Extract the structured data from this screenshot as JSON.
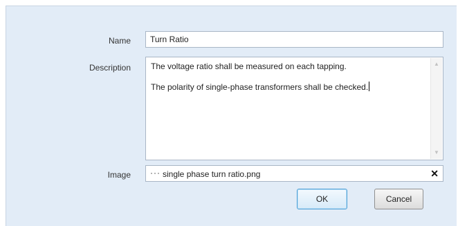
{
  "form": {
    "name_label": "Name",
    "name_value": "Turn Ratio",
    "description_label": "Description",
    "description_lines": [
      "The voltage ratio shall be measured on each tapping.",
      "The polarity of single-phase transformers shall be checked."
    ],
    "image_label": "Image",
    "image_browse": "···",
    "image_file": "single phase turn ratio.png",
    "image_clear": "✕"
  },
  "buttons": {
    "ok": "OK",
    "cancel": "Cancel"
  },
  "icons": {
    "scroll_up": "▲",
    "scroll_down": "▼"
  }
}
